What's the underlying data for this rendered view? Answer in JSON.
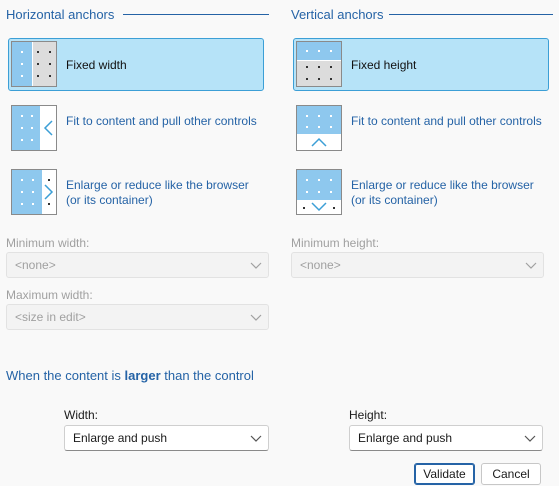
{
  "horizontal": {
    "title": "Horizontal anchors",
    "options": [
      {
        "label": "Fixed width",
        "icon": "fixed-width-icon",
        "selected": true
      },
      {
        "label": "Fit to content and pull other controls",
        "icon": "fit-content-horizontal-icon",
        "selected": false
      },
      {
        "label": "Enlarge or reduce like the browser (or its container)",
        "icon": "enlarge-reduce-horizontal-icon",
        "selected": false
      }
    ],
    "min_label": "Minimum width:",
    "min_value": "<none>",
    "max_label": "Maximum width:",
    "max_value": "<size in edit>"
  },
  "vertical": {
    "title": "Vertical anchors",
    "options": [
      {
        "label": "Fixed height",
        "icon": "fixed-height-icon",
        "selected": true
      },
      {
        "label": "Fit to content and pull other controls",
        "icon": "fit-content-vertical-icon",
        "selected": false
      },
      {
        "label": "Enlarge or reduce like the browser (or its container)",
        "icon": "enlarge-reduce-vertical-icon",
        "selected": false
      }
    ],
    "min_label": "Minimum height:",
    "min_value": "<none>"
  },
  "overflow": {
    "heading_pre": "When the content is ",
    "heading_bold": "larger",
    "heading_post": " than the control",
    "width_label": "Width:",
    "width_value": "Enlarge and push",
    "height_label": "Height:",
    "height_value": "Enlarge and push"
  },
  "buttons": {
    "validate": "Validate",
    "cancel": "Cancel"
  },
  "colors": {
    "accent": "#2563a6",
    "selected_bg": "#b6e3f8",
    "selected_border": "#3c9fd6",
    "icon_fill": "#8ec8ee"
  }
}
